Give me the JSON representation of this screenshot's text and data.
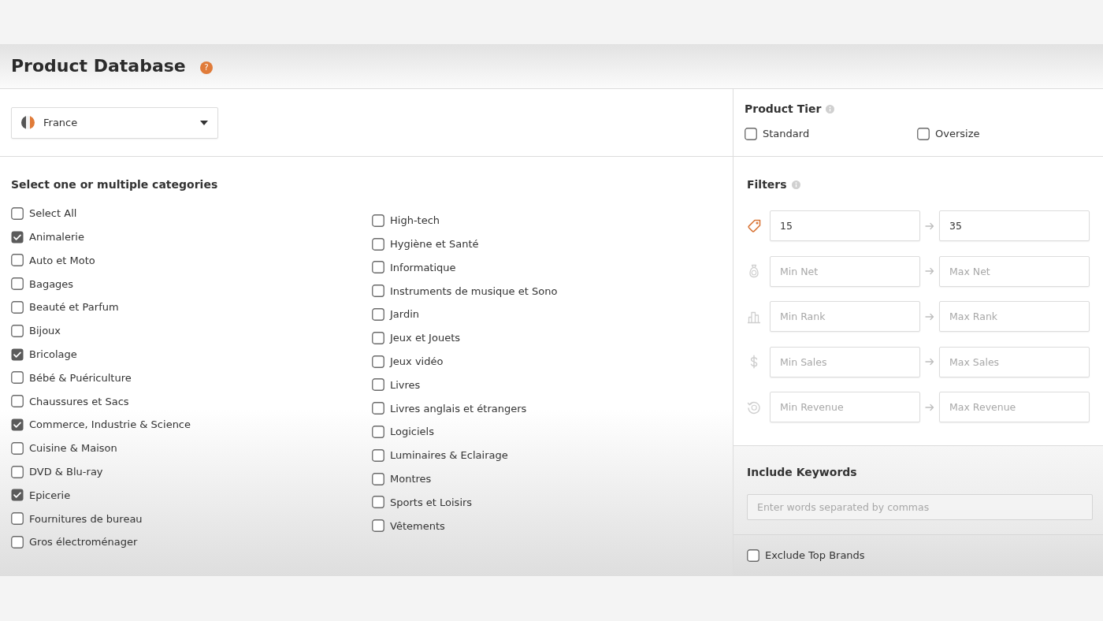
{
  "page_title": "Product Database",
  "help_mark": "?",
  "marketplace": {
    "value": "France"
  },
  "product_tier": {
    "title": "Product Tier",
    "options": [
      {
        "label": "Standard",
        "checked": false
      },
      {
        "label": "Oversize",
        "checked": false
      }
    ]
  },
  "categories": {
    "title": "Select one or multiple categories",
    "columns": [
      [
        {
          "label": "Select All",
          "checked": false
        },
        {
          "label": "Animalerie",
          "checked": true
        },
        {
          "label": "Auto et Moto",
          "checked": false
        },
        {
          "label": "Bagages",
          "checked": false
        },
        {
          "label": "Beauté et Parfum",
          "checked": false
        },
        {
          "label": "Bijoux",
          "checked": false
        },
        {
          "label": "Bricolage",
          "checked": true
        },
        {
          "label": "Bébé & Puériculture",
          "checked": false
        },
        {
          "label": "Chaussures et Sacs",
          "checked": false
        },
        {
          "label": "Commerce, Industrie & Science",
          "checked": true
        },
        {
          "label": "Cuisine & Maison",
          "checked": false
        },
        {
          "label": "DVD & Blu-ray",
          "checked": false
        },
        {
          "label": "Epicerie",
          "checked": true
        },
        {
          "label": "Fournitures de bureau",
          "checked": false
        },
        {
          "label": "Gros électroménager",
          "checked": false
        }
      ],
      [
        {
          "label": "High-tech",
          "checked": false
        },
        {
          "label": "Hygiène et Santé",
          "checked": false
        },
        {
          "label": "Informatique",
          "checked": false
        },
        {
          "label": "Instruments de musique et Sono",
          "checked": false
        },
        {
          "label": "Jardin",
          "checked": false
        },
        {
          "label": "Jeux et Jouets",
          "checked": false
        },
        {
          "label": "Jeux vidéo",
          "checked": false
        },
        {
          "label": "Livres",
          "checked": false
        },
        {
          "label": "Livres anglais et étrangers",
          "checked": false
        },
        {
          "label": "Logiciels",
          "checked": false
        },
        {
          "label": "Luminaires & Eclairage",
          "checked": false
        },
        {
          "label": "Montres",
          "checked": false
        },
        {
          "label": "Sports et Loisirs",
          "checked": false
        },
        {
          "label": "Vêtements",
          "checked": false
        }
      ]
    ]
  },
  "filters": {
    "title": "Filters",
    "rows": [
      {
        "kind": "price",
        "min": {
          "value": "15"
        },
        "max": {
          "value": "35"
        }
      },
      {
        "kind": "net",
        "min": {
          "placeholder": "Min Net"
        },
        "max": {
          "placeholder": "Max Net"
        }
      },
      {
        "kind": "rank",
        "min": {
          "placeholder": "Min Rank"
        },
        "max": {
          "placeholder": "Max Rank"
        }
      },
      {
        "kind": "sales",
        "min": {
          "placeholder": "Min Sales"
        },
        "max": {
          "placeholder": "Max Sales"
        }
      },
      {
        "kind": "revenue",
        "min": {
          "placeholder": "Min Revenue"
        },
        "max": {
          "placeholder": "Max Revenue"
        }
      }
    ]
  },
  "include_keywords": {
    "title": "Include Keywords",
    "placeholder": "Enter words separated by commas"
  },
  "exclude_top_brands": {
    "label": "Exclude Top Brands",
    "checked": false
  }
}
